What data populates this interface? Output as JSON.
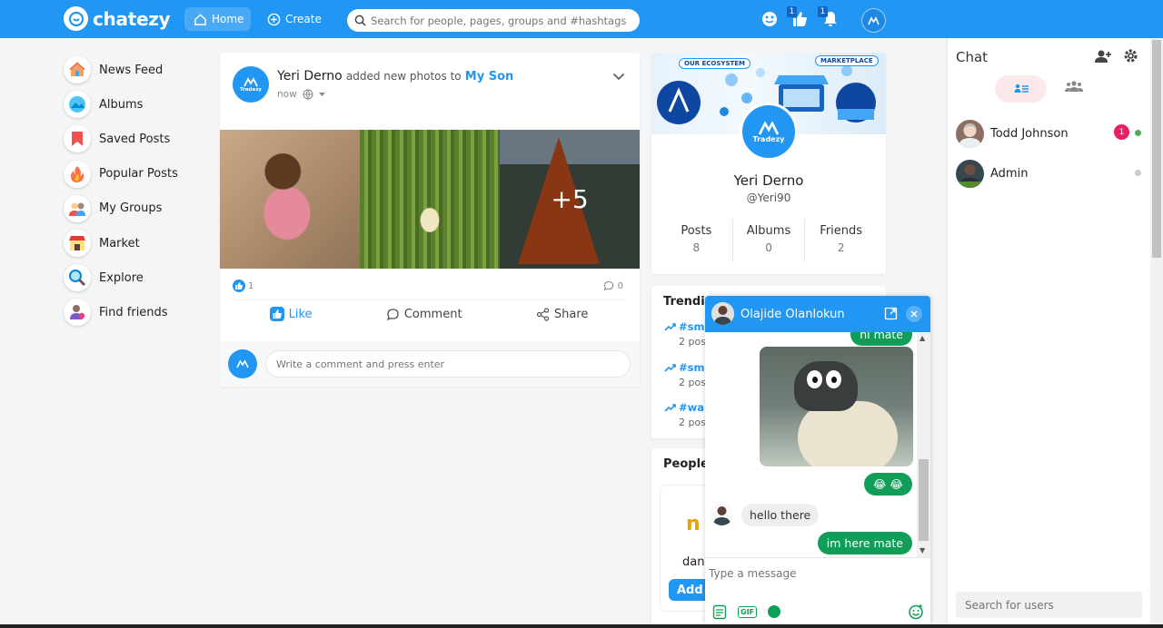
{
  "header": {
    "logo_text": "chatezy",
    "nav_home": "Home",
    "nav_create": "Create",
    "search_placeholder": "Search for people, pages, groups and #hashtags",
    "friend_requests_count": "1",
    "notifications_count": "1"
  },
  "leftnav": {
    "items": [
      {
        "label": "News Feed",
        "icon": "news-feed-icon"
      },
      {
        "label": "Albums",
        "icon": "albums-icon"
      },
      {
        "label": "Saved Posts",
        "icon": "saved-posts-icon"
      },
      {
        "label": "Popular Posts",
        "icon": "popular-posts-icon"
      },
      {
        "label": "My Groups",
        "icon": "groups-icon"
      },
      {
        "label": "Market",
        "icon": "market-icon"
      },
      {
        "label": "Explore",
        "icon": "explore-icon"
      },
      {
        "label": "Find friends",
        "icon": "find-friends-icon"
      }
    ]
  },
  "post": {
    "author": "Yeri Derno",
    "action": "added new photos to",
    "album": "My Son",
    "time": "now",
    "avatar_text": "Tradezy",
    "more_photos": "+5",
    "likes": "1",
    "comments": "0",
    "like_label": "Like",
    "comment_label": "Comment",
    "share_label": "Share",
    "comment_placeholder": "Write a comment and press enter"
  },
  "profile": {
    "cover_tag1": "OUR ECOSYSTEM",
    "cover_tag2": "MARKETPLACE",
    "name": "Yeri Derno",
    "handle": "@Yeri90",
    "stats": [
      {
        "label": "Posts",
        "value": "8"
      },
      {
        "label": "Albums",
        "value": "0"
      },
      {
        "label": "Friends",
        "value": "2"
      }
    ]
  },
  "trending": {
    "title": "Trendin",
    "items": [
      {
        "tag": "#sm",
        "count": "2 pos"
      },
      {
        "tag": "#sm",
        "count": "2 pos"
      },
      {
        "tag": "#wa",
        "count": "2 pos"
      }
    ]
  },
  "people": {
    "title": "People",
    "card_initial": "n",
    "card_name": "dan",
    "add_label": "Add"
  },
  "chat_popup": {
    "contact_name": "Olajide Olanlokun",
    "msg_partial": "hi mate",
    "msg_emoji": "😂 😂",
    "msg_them": "hello there",
    "msg_me": "im here mate",
    "input_placeholder": "Type a message",
    "gif_label": "GIF",
    "color_send": "#0f9d58"
  },
  "chat_sidebar": {
    "title": "Chat",
    "users": [
      {
        "name": "Todd Johnson",
        "badge": "1",
        "status_color": "#4caf50"
      },
      {
        "name": "Admin",
        "badge": "",
        "status_color": "#cccccc"
      }
    ],
    "search_placeholder": "Search for users"
  },
  "colors": {
    "brand": "#2196f3",
    "accent_green": "#0f9d58",
    "badge_pink": "#e91e63"
  }
}
